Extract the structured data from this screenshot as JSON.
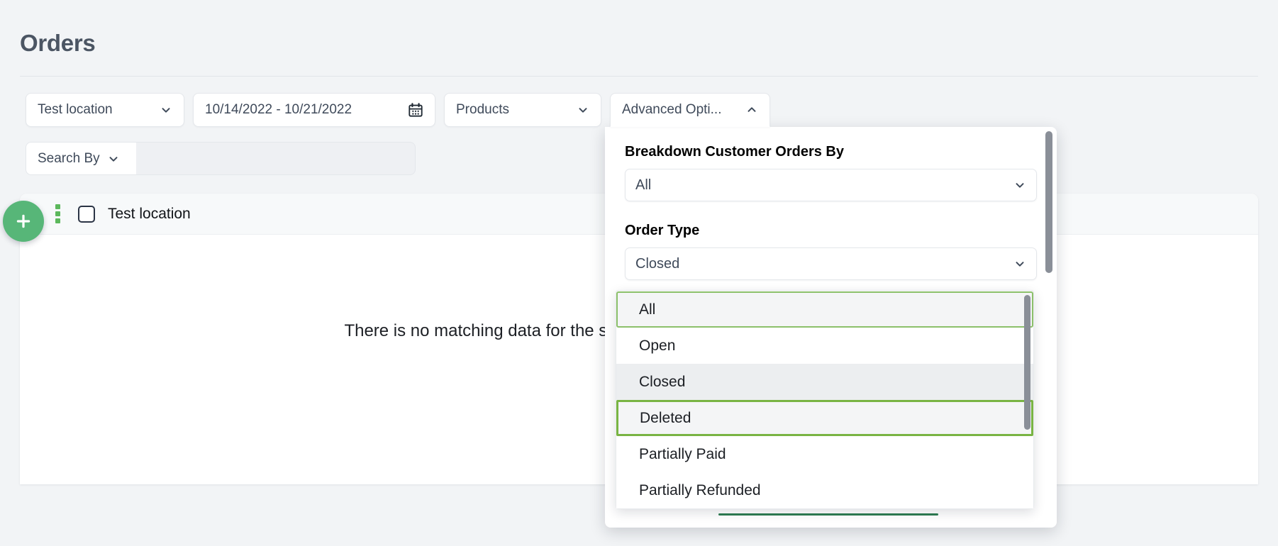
{
  "page": {
    "title": "Orders"
  },
  "filters": {
    "location": {
      "label": "Test location",
      "icon": "chevron-down-icon"
    },
    "date_range": {
      "label": "10/14/2022 - 10/21/2022",
      "icon": "calendar-icon"
    },
    "products": {
      "label": "Products",
      "icon": "chevron-down-icon"
    },
    "advanced_options": {
      "label": "Advanced Opti...",
      "icon": "chevron-up-icon"
    }
  },
  "search": {
    "search_by_label": "Search By",
    "search_by_icon": "chevron-down-icon",
    "input_value": "",
    "input_placeholder": ""
  },
  "list": {
    "row_label": "Test location",
    "checkbox_checked": false,
    "drag_handle_icon": "drag-dots-icon",
    "empty_message": "There is no matching data for the selected filters. Please adjust your selection."
  },
  "add_button": {
    "icon": "plus-icon",
    "label": "+"
  },
  "advanced_panel": {
    "breakdown": {
      "label": "Breakdown Customer Orders By",
      "value": "All",
      "icon": "chevron-down-icon"
    },
    "order_type": {
      "label": "Order Type",
      "value": "Closed",
      "icon": "chevron-down-icon",
      "options": [
        {
          "label": "All",
          "state": "focused"
        },
        {
          "label": "Open",
          "state": "normal"
        },
        {
          "label": "Closed",
          "state": "selected"
        },
        {
          "label": "Deleted",
          "state": "active"
        },
        {
          "label": "Partially Paid",
          "state": "normal"
        },
        {
          "label": "Partially Refunded",
          "state": "normal"
        }
      ]
    }
  },
  "colors": {
    "accent_green": "#57b678",
    "option_outline": "#79b443",
    "apply_bar": "#2f7d52",
    "title_text": "#4b5563",
    "page_bg": "#f2f4f6"
  }
}
